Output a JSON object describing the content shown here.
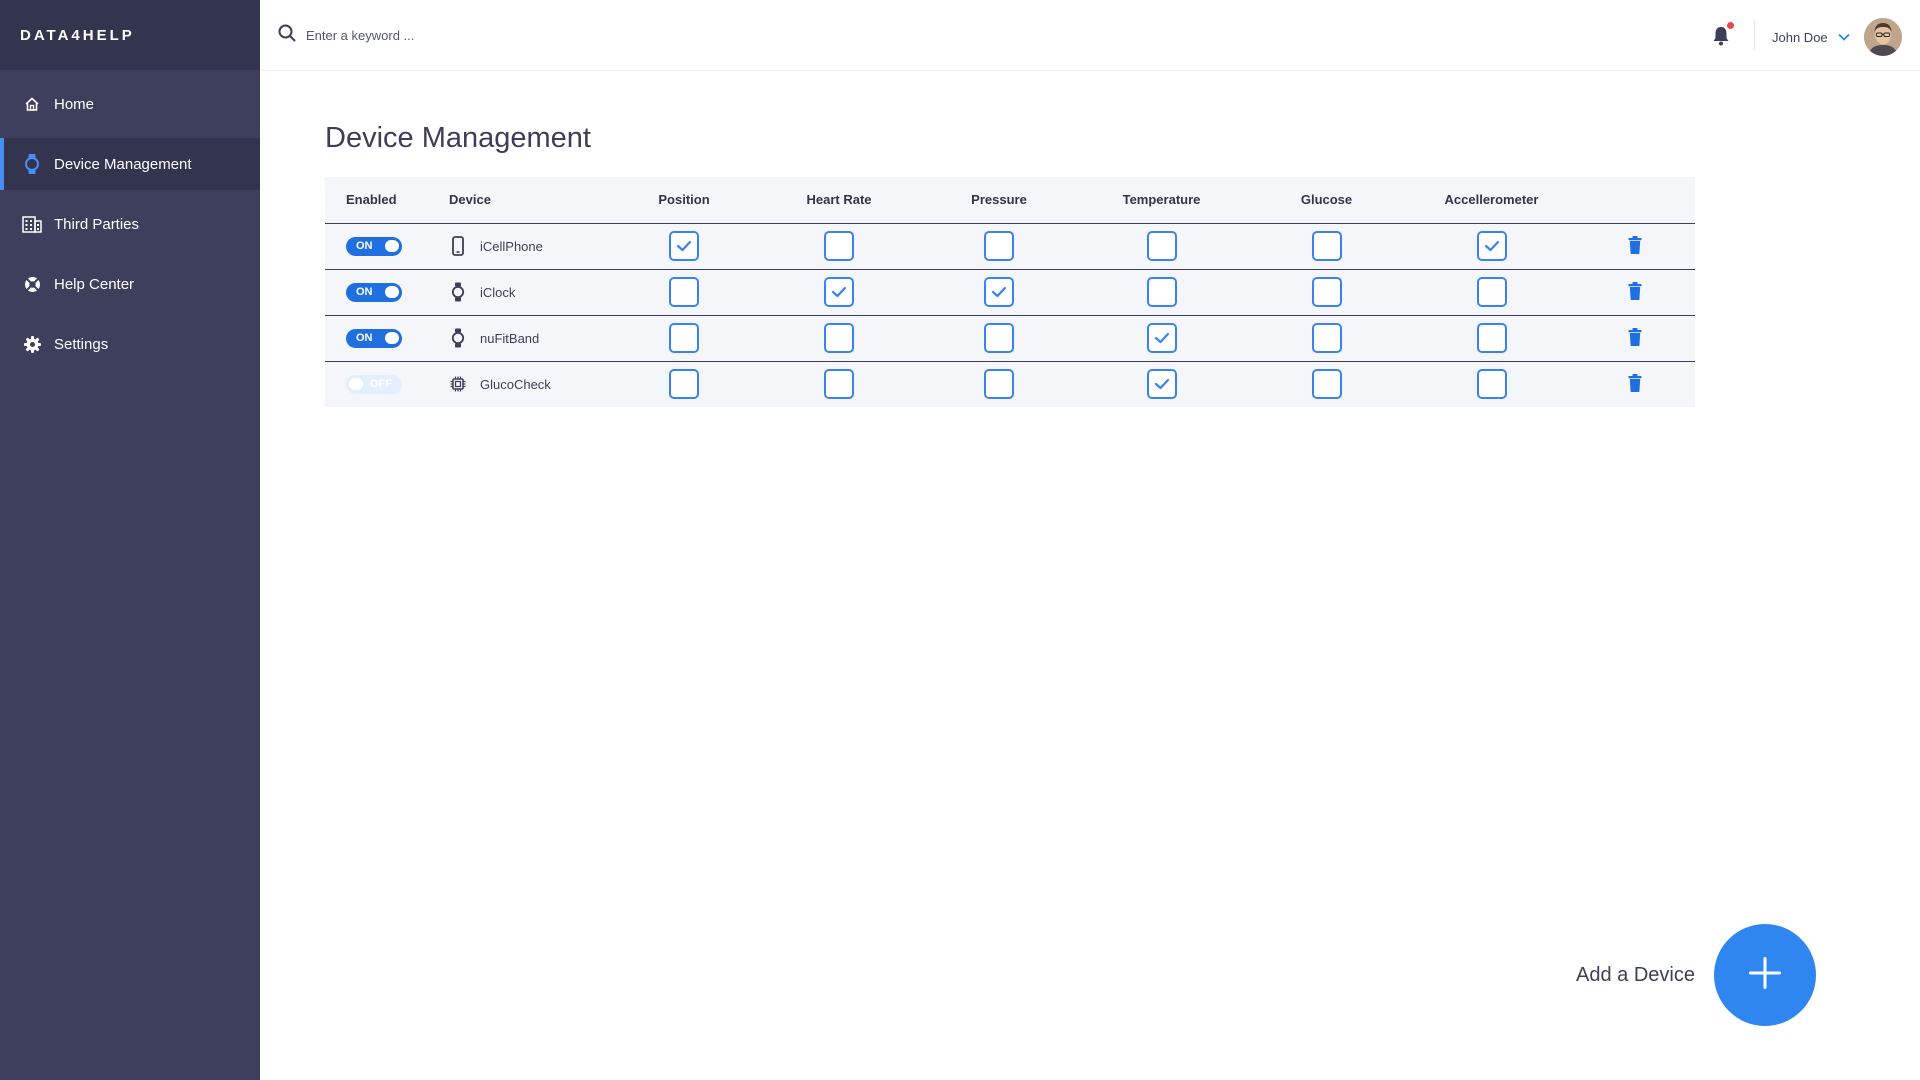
{
  "brand": "DATA4HELP",
  "sidebar": {
    "items": [
      {
        "label": "Home",
        "icon": "home-icon",
        "active": false
      },
      {
        "label": "Device Management",
        "icon": "watch-icon",
        "active": true
      },
      {
        "label": "Third Parties",
        "icon": "building-icon",
        "active": false
      },
      {
        "label": "Help Center",
        "icon": "lifebuoy-icon",
        "active": false
      },
      {
        "label": "Settings",
        "icon": "gear-icon",
        "active": false
      }
    ]
  },
  "search": {
    "placeholder": "Enter a keyword ..."
  },
  "user": {
    "name": "John Doe",
    "has_notification": true
  },
  "page": {
    "title": "Device Management"
  },
  "table": {
    "headers": {
      "enabled": "Enabled",
      "device": "Device",
      "position": "Position",
      "heart_rate": "Heart Rate",
      "pressure": "Pressure",
      "temperature": "Temperature",
      "glucose": "Glucose",
      "accelerometer": "Accellerometer"
    },
    "rows": [
      {
        "toggle": "ON",
        "enabled": true,
        "device": "iCellPhone",
        "icon": "phone-icon",
        "position": true,
        "heart_rate": false,
        "pressure": false,
        "temperature": false,
        "glucose": false,
        "accelerometer": true
      },
      {
        "toggle": "ON",
        "enabled": true,
        "device": "iClock",
        "icon": "watch-icon",
        "position": false,
        "heart_rate": true,
        "pressure": true,
        "temperature": false,
        "glucose": false,
        "accelerometer": false
      },
      {
        "toggle": "ON",
        "enabled": true,
        "device": "nuFitBand",
        "icon": "watch-icon",
        "position": false,
        "heart_rate": false,
        "pressure": false,
        "temperature": true,
        "glucose": false,
        "accelerometer": false
      },
      {
        "toggle": "OFF",
        "enabled": false,
        "device": "GlucoCheck",
        "icon": "chip-icon",
        "position": false,
        "heart_rate": false,
        "pressure": false,
        "temperature": true,
        "glucose": false,
        "accelerometer": false
      }
    ]
  },
  "fab": {
    "label": "Add a Device"
  },
  "colors": {
    "sidebar": "#3e3f5c",
    "sidebar_active": "#33344d",
    "accent": "#2f86f0",
    "toggle_on": "#1f6fe0"
  }
}
